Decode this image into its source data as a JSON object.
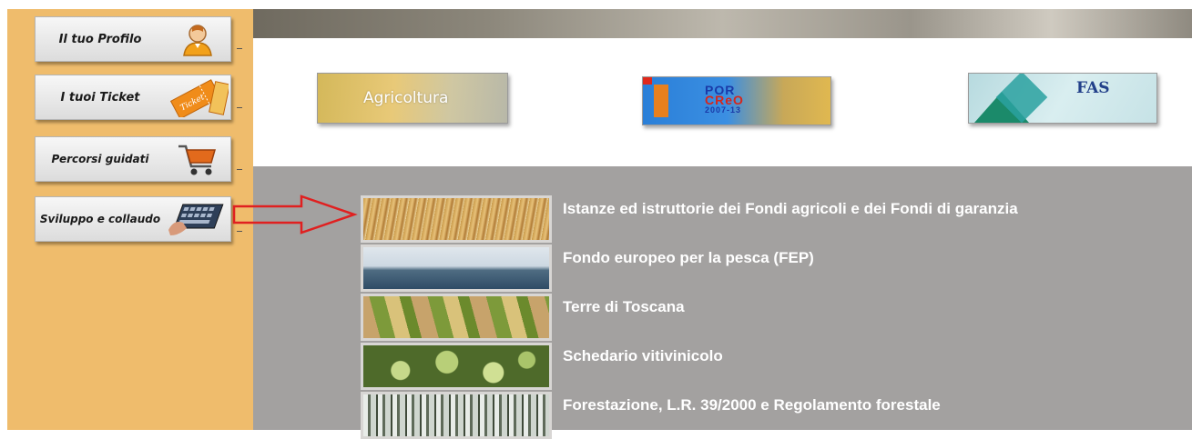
{
  "sidebar": {
    "items": [
      {
        "label": "Il tuo Profilo",
        "icon": "user-icon"
      },
      {
        "label": "I tuoi Ticket",
        "icon": "ticket-icon"
      },
      {
        "label": "Percorsi guidati",
        "icon": "cart-icon"
      },
      {
        "label": "Sviluppo e collaudo",
        "icon": "keyboard-icon"
      }
    ]
  },
  "banners": {
    "agricoltura": "Agricoltura",
    "por": {
      "line1": "POR",
      "line2": "CReO",
      "line3": "2007-13"
    },
    "fas": "FAS"
  },
  "main": {
    "links": [
      "Istanze ed istruttorie dei Fondi agricoli e dei Fondi di garanzia",
      "Fondo europeo per la pesca (FEP)",
      "Terre di Toscana",
      "Schedario vitivinicolo",
      "Forestazione, L.R. 39/2000 e Regolamento forestale"
    ]
  },
  "colors": {
    "sidebar": "#efbc6c",
    "main": "#a3a1a0",
    "arrow": "#e02020"
  }
}
